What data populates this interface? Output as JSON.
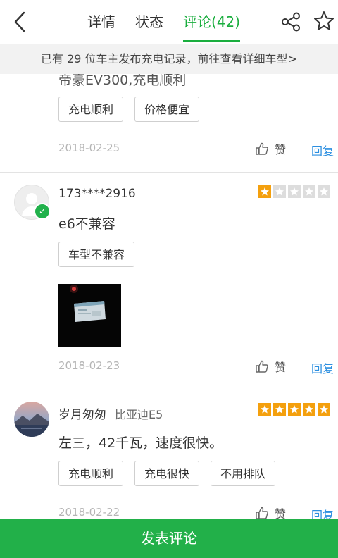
{
  "header": {
    "tabs": [
      {
        "label": "详情"
      },
      {
        "label": "状态"
      },
      {
        "label": "评论(42)"
      }
    ],
    "active_tab": 2,
    "accent_color": "#1aae3e"
  },
  "notice": {
    "text": "已有 29 位车主发布充电记录，前往查看详细车型>"
  },
  "reviews": [
    {
      "text": "帝豪EV300,充电顺利",
      "tags": [
        "充电顺利",
        "价格便宜"
      ],
      "date": "2018-02-25",
      "like_label": "赞",
      "reply_label": "回复"
    },
    {
      "username": "173****2916",
      "avatar": "default-avatar",
      "verified": true,
      "verified_mark": "✓",
      "rating": 1,
      "text": "e6不兼容",
      "tags": [
        "车型不兼容"
      ],
      "has_photo": true,
      "date": "2018-02-23",
      "like_label": "赞",
      "reply_label": "回复"
    },
    {
      "username": "岁月匆匆",
      "car_model": "比亚迪E5",
      "avatar": "landscape-avatar",
      "rating": 5,
      "text": "左三，42千瓦，速度很快。",
      "tags": [
        "充电顺利",
        "充电很快",
        "不用排队"
      ],
      "date": "2018-02-22",
      "like_label": "赞",
      "reply_label": "回复"
    }
  ],
  "bottom_bar": {
    "label": "发表评论",
    "color": "#22b049"
  }
}
